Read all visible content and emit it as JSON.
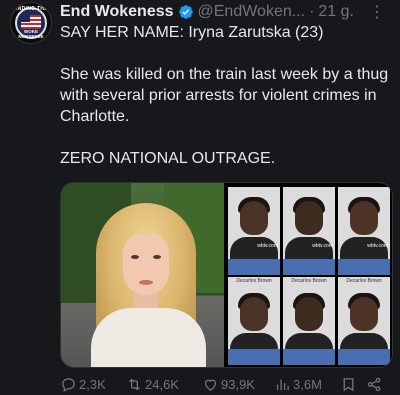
{
  "author": {
    "display_name": "End Wokeness",
    "handle": "@EndWoken...",
    "time": "21 g.",
    "separator": "·",
    "avatar_text_top": "ENDING THE",
    "avatar_text_bottom": "WOKE NONSENSE"
  },
  "tweet": {
    "lines": [
      "SAY HER NAME: Iryna Zarutska (23)",
      "She was killed on the train last week by a thug with several prior arrests for violent crimes in Charlotte.",
      "ZERO NATIONAL OUTRAGE."
    ]
  },
  "media": {
    "mugshots_top": [
      {
        "watermark": "wbtv.com"
      },
      {
        "watermark": "wbtv.com"
      },
      {
        "watermark": "wbtv.com"
      }
    ],
    "mugshots_bottom": [
      {
        "label": "Decarlos Brown"
      },
      {
        "label": "Decarlos Brown"
      },
      {
        "label": "Decarlos Brown"
      }
    ]
  },
  "actions": {
    "replies": "2,3K",
    "retweets": "24,6K",
    "likes": "93,9K",
    "views": "3,6M"
  },
  "colors": {
    "background": "#16181c",
    "text": "#e7e9ea",
    "muted": "#71767b",
    "verified": "#1d9bf0"
  }
}
